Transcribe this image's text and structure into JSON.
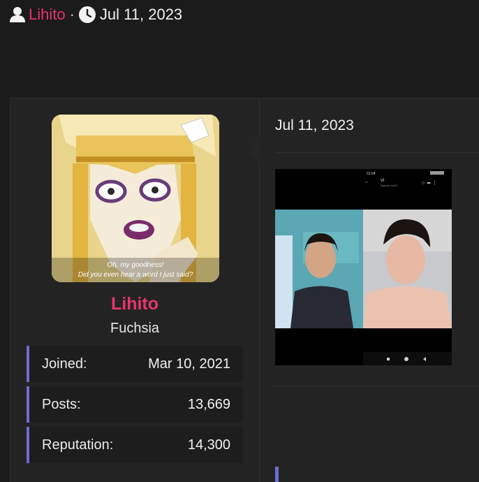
{
  "thread_header": {
    "author": "Lihito",
    "separator": "·",
    "date": "Jul 11, 2023"
  },
  "user": {
    "name": "Lihito",
    "title": "Fuchsia",
    "avatar_caption_line1": "Oh, my goodness!",
    "avatar_caption_line2": "Did you even hear a word I just said?",
    "stats": [
      {
        "label": "Joined:",
        "value": "Mar 10, 2021"
      },
      {
        "label": "Posts:",
        "value": "13,669"
      },
      {
        "label": "Reputation:",
        "value": "14,300"
      }
    ]
  },
  "post": {
    "date": "Jul 11, 2023",
    "attachment": {
      "status_time": "01:04",
      "contact_name": "Vi",
      "contact_status": "Saiu às 19:57"
    }
  },
  "colors": {
    "accent_pink": "#e8336b",
    "accent_blue": "#6a6ed2",
    "background": "#1b1b1b",
    "panel": "#232323"
  }
}
